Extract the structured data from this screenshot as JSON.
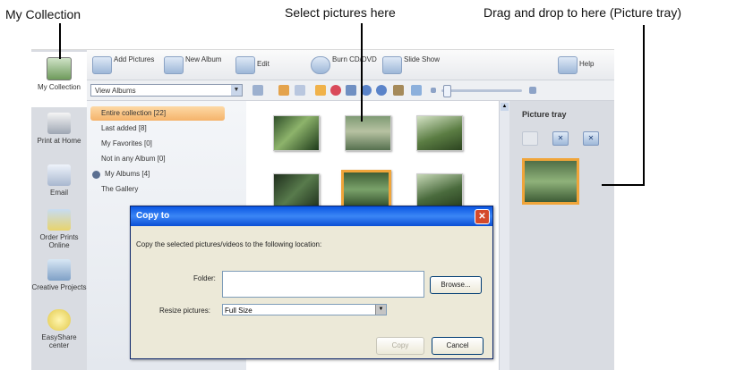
{
  "callouts": {
    "my_collection": "My Collection",
    "select_pictures": "Select pictures here",
    "drag_drop": "Drag and drop to here (Picture tray)"
  },
  "left_nav": [
    {
      "label": "My Collection",
      "icon": "my-collection-icon"
    },
    {
      "label": "Print at Home",
      "icon": "printer-icon"
    },
    {
      "label": "Email",
      "icon": "email-icon"
    },
    {
      "label": "Order Prints Online",
      "icon": "order-prints-icon"
    },
    {
      "label": "Creative Projects",
      "icon": "creative-projects-icon"
    },
    {
      "label": "EasyShare center",
      "icon": "lightbulb-icon"
    }
  ],
  "toolbar": {
    "add_pictures": "Add Pictures",
    "new_album": "New Album",
    "edit": "Edit",
    "burn": "Burn CD/DVD",
    "slide_show": "Slide Show",
    "help": "Help"
  },
  "view_select": {
    "value": "View Albums"
  },
  "albums": [
    "Entire collection [22]",
    "Last added [8]",
    "My Favorites [0]",
    "Not in any Album [0]",
    "My Albums [4]",
    "The Gallery"
  ],
  "tray": {
    "title": "Picture tray"
  },
  "dialog": {
    "title": "Copy to",
    "message": "Copy the selected pictures/videos to the following location:",
    "folder_label": "Folder:",
    "folder_value": "",
    "browse": "Browse...",
    "resize_label": "Resize pictures:",
    "resize_value": "Full Size",
    "copy": "Copy",
    "cancel": "Cancel"
  },
  "colors": {
    "selection": "#f0a53a",
    "titlebar": "#0a56e3"
  }
}
